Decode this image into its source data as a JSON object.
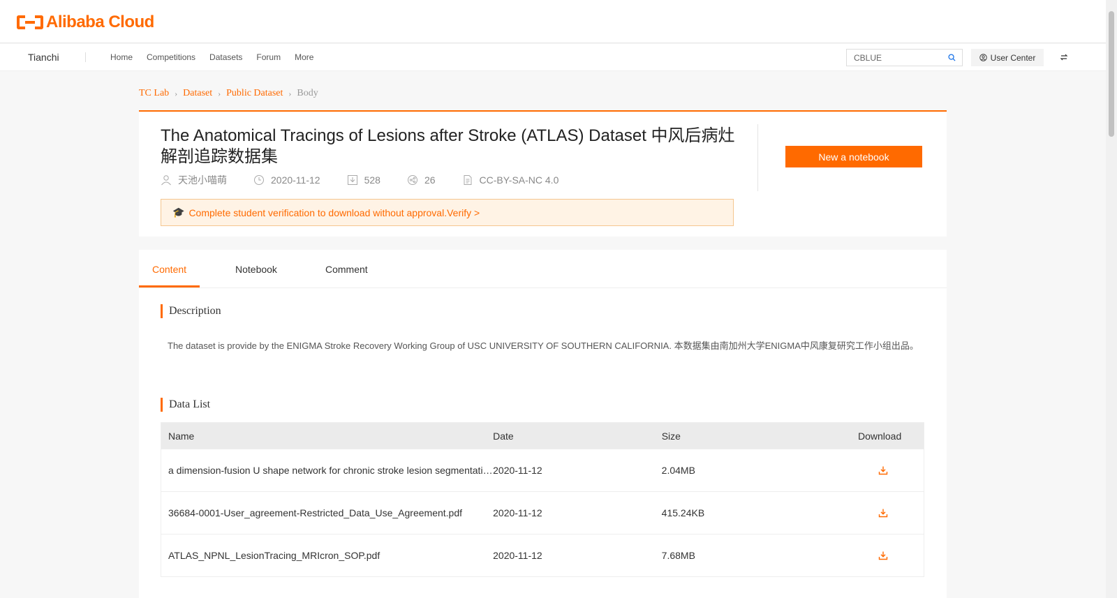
{
  "header": {
    "logo_text": "Alibaba Cloud",
    "brand": "Tianchi",
    "nav": [
      "Home",
      "Competitions",
      "Datasets",
      "Forum",
      "More"
    ],
    "search_value": "CBLUE",
    "user_center": "User Center"
  },
  "breadcrumb": [
    "TC Lab",
    "Dataset",
    "Public Dataset",
    "Body"
  ],
  "dataset": {
    "title": "The Anatomical Tracings of Lesions after Stroke (ATLAS) Dataset 中风后病灶解剖追踪数据集",
    "author": "天池小喵萌",
    "date": "2020-11-12",
    "downloads": "528",
    "shares": "26",
    "license": "CC-BY-SA-NC 4.0",
    "new_notebook": "New a notebook",
    "notice": "Complete student verification to download without approval.Verify >"
  },
  "tabs": [
    "Content",
    "Notebook",
    "Comment"
  ],
  "description": {
    "heading": "Description",
    "text": "The dataset is provide by the ENIGMA Stroke Recovery Working Group of USC UNIVERSITY OF SOUTHERN CALIFORNIA. 本数据集由南加州大学ENIGMA中风康复研究工作小组出品。"
  },
  "data_list": {
    "heading": "Data List",
    "columns": [
      "Name",
      "Date",
      "Size",
      "Download"
    ],
    "rows": [
      {
        "name": "a dimension-fusion U shape network for chronic stroke lesion segmentation ...",
        "date": "2020-11-12",
        "size": "2.04MB"
      },
      {
        "name": "36684-0001-User_agreement-Restricted_Data_Use_Agreement.pdf",
        "date": "2020-11-12",
        "size": "415.24KB"
      },
      {
        "name": "ATLAS_NPNL_LesionTracing_MRIcron_SOP.pdf",
        "date": "2020-11-12",
        "size": "7.68MB"
      }
    ]
  },
  "colors": {
    "accent": "#ff6a00",
    "notice_bg": "#fff3e5"
  }
}
